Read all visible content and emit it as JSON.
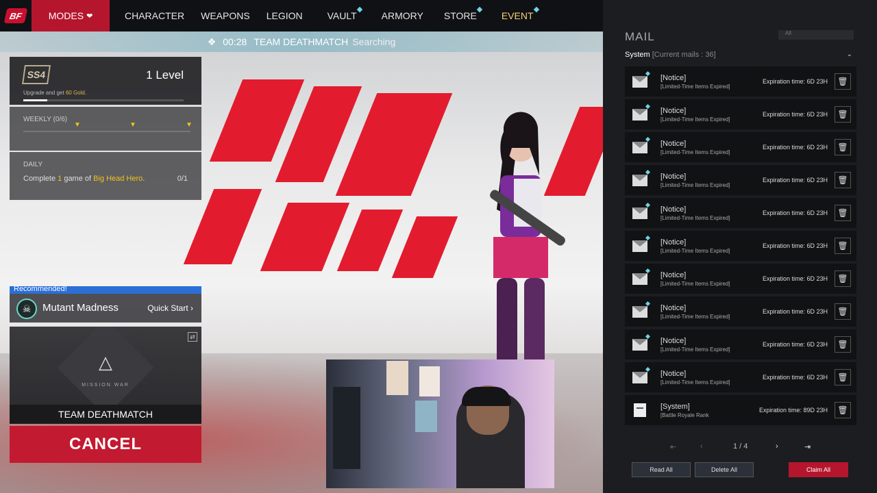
{
  "nav": {
    "logo_text": "BF",
    "modes_label": "MODES",
    "items": [
      {
        "label": "CHARACTER",
        "new": false
      },
      {
        "label": "WEAPONS",
        "new": false
      },
      {
        "label": "LEGION",
        "new": false
      },
      {
        "label": "VAULT",
        "new": true
      },
      {
        "label": "ARMORY",
        "new": false
      },
      {
        "label": "STORE",
        "new": true
      },
      {
        "label": "EVENT",
        "new": true
      }
    ]
  },
  "search": {
    "timer": "00:28",
    "mode": "TEAM DEATHMATCH",
    "state": "Searching"
  },
  "level": {
    "emblem": "SS4",
    "label": "1 Level",
    "sub_prefix": "Upgrade and get ",
    "sub_gold": "60 Gold",
    "sub_suffix": ".",
    "progress": 0.15
  },
  "weekly": {
    "label": "WEEKLY (0/6)"
  },
  "daily": {
    "label": "DAILY",
    "prefix": "Complete ",
    "count": "1",
    "middle": " game of ",
    "mode": "Big Head Hero",
    "suffix": ".",
    "progress": "0/1"
  },
  "recommended": {
    "label": "Recommended!",
    "name": "Mutant Madness",
    "quick_start": "Quick Start"
  },
  "mode_card": {
    "sub": "MISSION WAR",
    "name": "TEAM DEATHMATCH"
  },
  "cancel_label": "CANCEL",
  "mail": {
    "title": "MAIL",
    "sort_label": "All",
    "category": "System",
    "current": "[Current mails : 36]",
    "rows": [
      {
        "subject": "[Notice]",
        "desc": "[Limited-Time Items Expired]",
        "expiration": "Expiration time: 6D 23H",
        "type": "notice"
      },
      {
        "subject": "[Notice]",
        "desc": "[Limited-Time Items Expired]",
        "expiration": "Expiration time: 6D 23H",
        "type": "notice"
      },
      {
        "subject": "[Notice]",
        "desc": "[Limited-Time Items Expired]",
        "expiration": "Expiration time: 6D 23H",
        "type": "notice"
      },
      {
        "subject": "[Notice]",
        "desc": "[Limited-Time Items Expired]",
        "expiration": "Expiration time: 6D 23H",
        "type": "notice"
      },
      {
        "subject": "[Notice]",
        "desc": "[Limited-Time Items Expired]",
        "expiration": "Expiration time: 6D 23H",
        "type": "notice"
      },
      {
        "subject": "[Notice]",
        "desc": "[Limited-Time Items Expired]",
        "expiration": "Expiration time: 6D 23H",
        "type": "notice"
      },
      {
        "subject": "[Notice]",
        "desc": "[Limited-Time Items Expired]",
        "expiration": "Expiration time: 6D 23H",
        "type": "notice"
      },
      {
        "subject": "[Notice]",
        "desc": "[Limited-Time Items Expired]",
        "expiration": "Expiration time: 6D 23H",
        "type": "notice"
      },
      {
        "subject": "[Notice]",
        "desc": "[Limited-Time Items Expired]",
        "expiration": "Expiration time: 6D 23H",
        "type": "notice"
      },
      {
        "subject": "[Notice]",
        "desc": "[Limited-Time Items Expired]",
        "expiration": "Expiration time: 6D 23H",
        "type": "notice"
      },
      {
        "subject": "[System]",
        "desc": "[Battle Royale Rank",
        "expiration": "Expiration time: 89D 23H",
        "type": "system"
      }
    ],
    "pager": "1 / 4",
    "read_all": "Read All",
    "delete_all": "Delete All",
    "claim_all": "Claim All"
  },
  "colors": {
    "accent_red": "#c21a30",
    "new_dot": "#6fd3e6",
    "gold": "#e0b44a"
  }
}
